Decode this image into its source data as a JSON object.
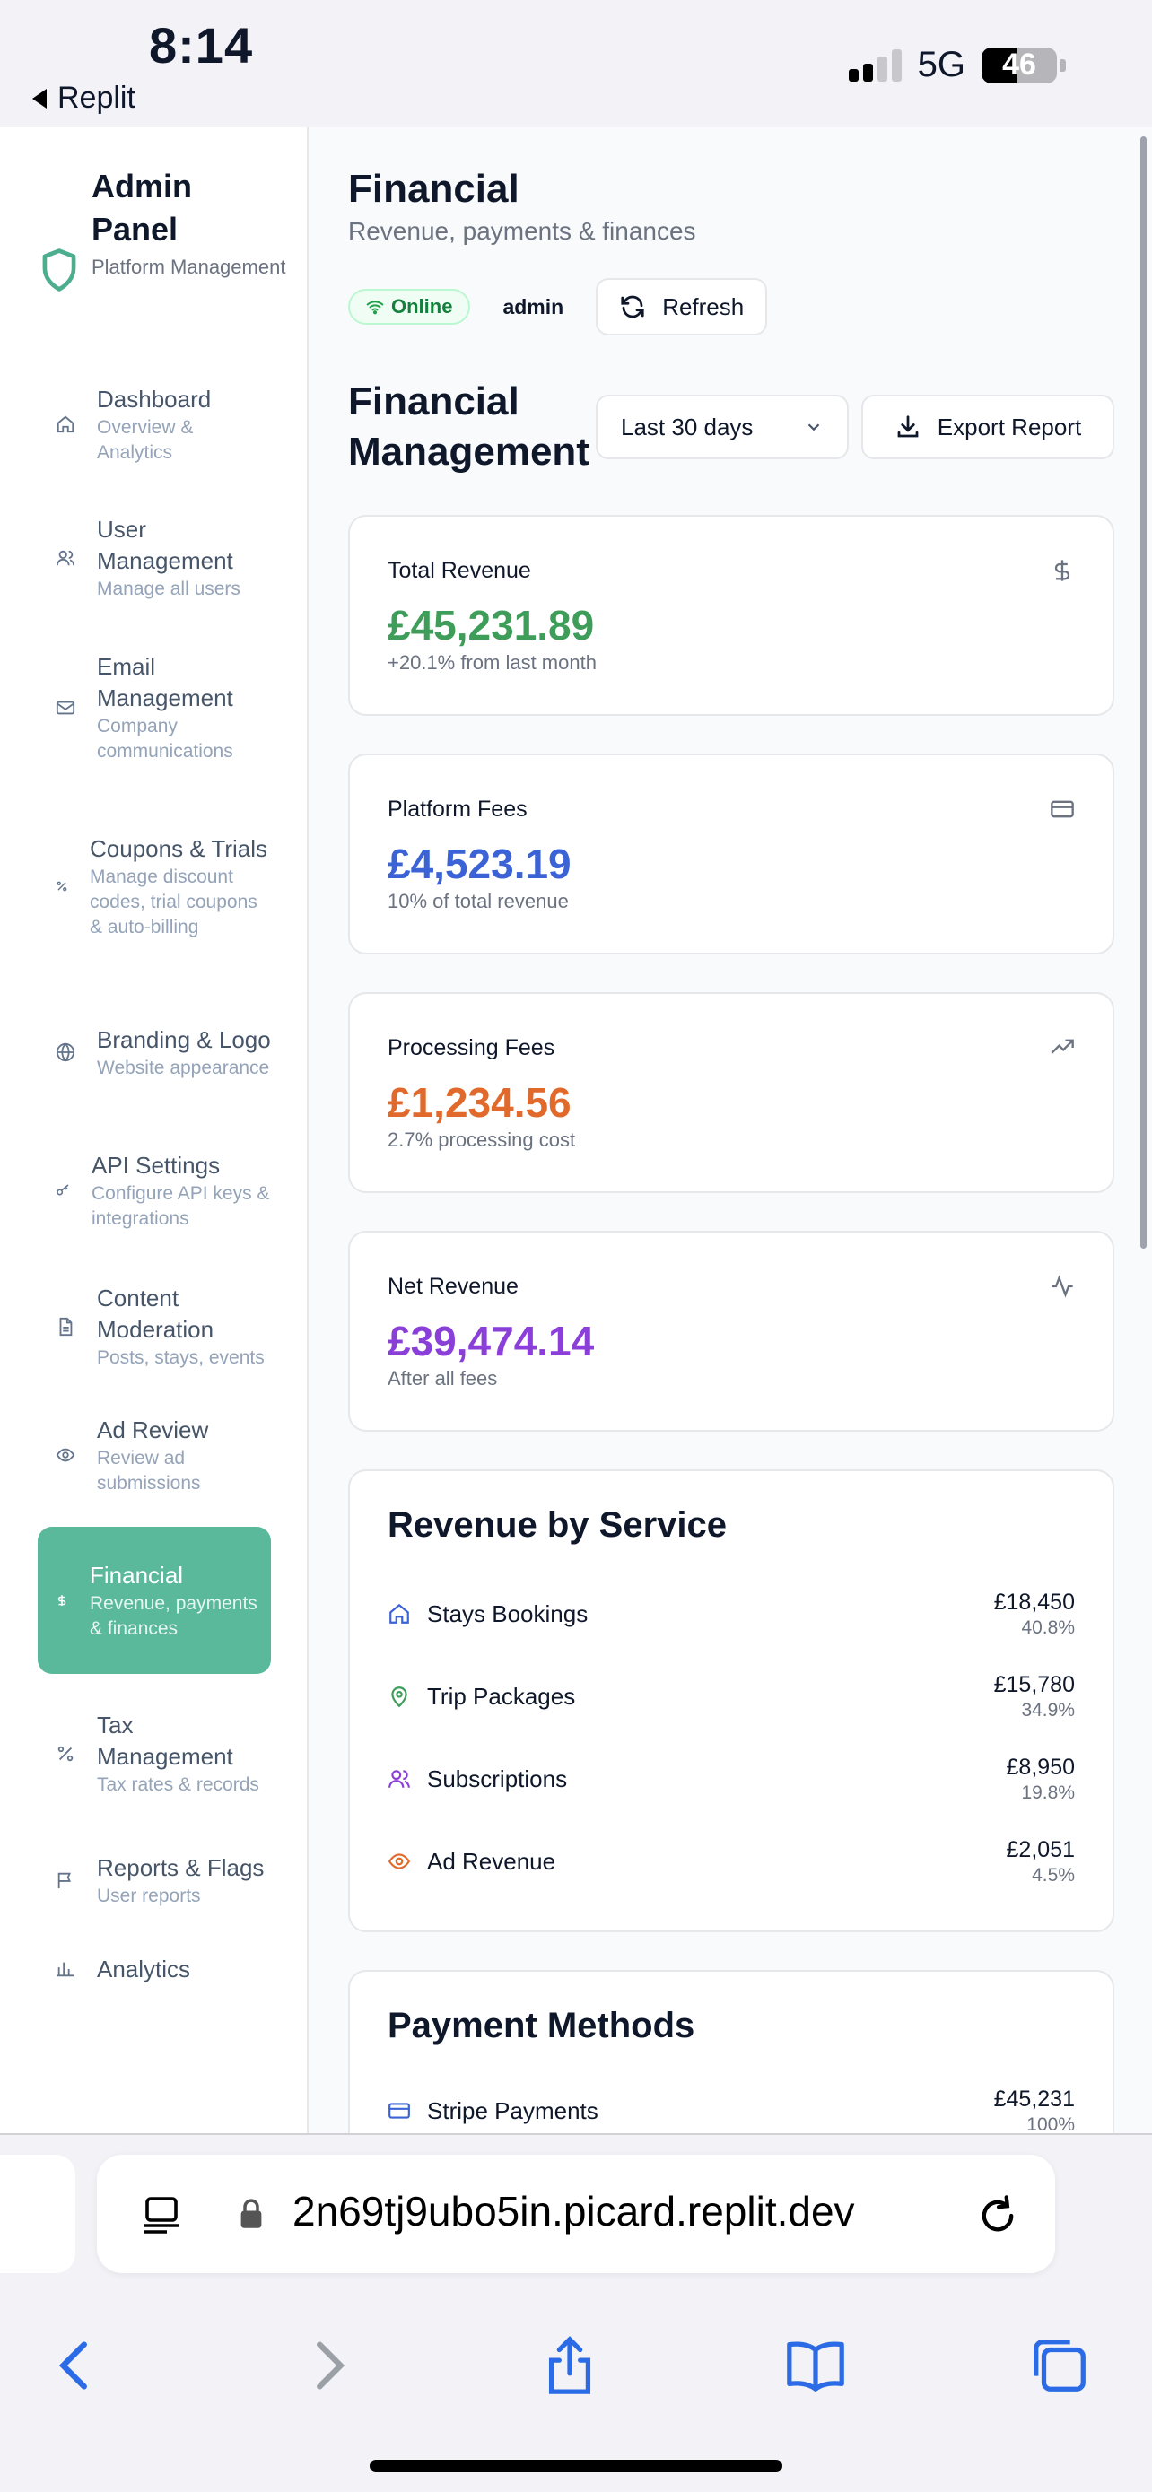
{
  "status_bar": {
    "time": "8:14",
    "back_label": "Replit",
    "network": "5G",
    "battery": "46",
    "battery_level": 0.46
  },
  "sidebar": {
    "title": "Admin Panel",
    "subtitle": "Platform Management",
    "items": [
      {
        "label": "Dashboard",
        "sub": "Overview & Analytics",
        "icon": "home-icon"
      },
      {
        "label": "User Management",
        "sub": "Manage all users",
        "icon": "users-icon"
      },
      {
        "label": "Email Management",
        "sub": "Company communications",
        "icon": "mail-icon"
      },
      {
        "label": "Coupons & Trials",
        "sub": "Manage discount codes, trial coupons & auto-billing",
        "icon": "percent-icon"
      },
      {
        "label": "Branding & Logo",
        "sub": "Website appearance",
        "icon": "globe-icon"
      },
      {
        "label": "API Settings",
        "sub": "Configure API keys & integrations",
        "icon": "key-icon"
      },
      {
        "label": "Content Moderation",
        "sub": "Posts, stays, events",
        "icon": "file-icon"
      },
      {
        "label": "Ad Review",
        "sub": "Review ad submissions",
        "icon": "eye-icon"
      },
      {
        "label": "Financial",
        "sub": "Revenue, payments & finances",
        "icon": "dollar-icon",
        "active": true
      },
      {
        "label": "Tax Management",
        "sub": "Tax rates & records",
        "icon": "percent-icon"
      },
      {
        "label": "Reports & Flags",
        "sub": "User reports",
        "icon": "flag-icon"
      },
      {
        "label": "Analytics",
        "sub": "",
        "icon": "chart-icon"
      }
    ]
  },
  "header": {
    "title": "Financial",
    "subtitle": "Revenue, payments & finances",
    "status": "Online",
    "user": "admin",
    "refresh_label": "Refresh"
  },
  "financial": {
    "title": "Financial Management",
    "range": "Last 30 days",
    "export_label": "Export Report"
  },
  "stats": [
    {
      "label": "Total Revenue",
      "value": "£45,231.89",
      "note": "+20.1% from last month",
      "color": "#3f9d5a",
      "icon": "dollar-icon"
    },
    {
      "label": "Platform Fees",
      "value": "£4,523.19",
      "note": "10% of total revenue",
      "color": "#3b63d6",
      "icon": "credit-card-icon"
    },
    {
      "label": "Processing Fees",
      "value": "£1,234.56",
      "note": "2.7% processing cost",
      "color": "#e0692b",
      "icon": "trending-up-icon"
    },
    {
      "label": "Net Revenue",
      "value": "£39,474.14",
      "note": "After all fees",
      "color": "#8b3fd9",
      "icon": "activity-icon"
    }
  ],
  "revenue_by_service": {
    "title": "Revenue by Service",
    "rows": [
      {
        "name": "Stays Bookings",
        "amount": "£18,450",
        "pct": "40.8%",
        "icon": "home-icon",
        "color": "#3b63d6"
      },
      {
        "name": "Trip Packages",
        "amount": "£15,780",
        "pct": "34.9%",
        "icon": "map-pin-icon",
        "color": "#3f9d5a"
      },
      {
        "name": "Subscriptions",
        "amount": "£8,950",
        "pct": "19.8%",
        "icon": "users-icon",
        "color": "#8b3fd9"
      },
      {
        "name": "Ad Revenue",
        "amount": "£2,051",
        "pct": "4.5%",
        "icon": "eye-icon",
        "color": "#e0692b"
      }
    ]
  },
  "payment_methods": {
    "title": "Payment Methods",
    "rows": [
      {
        "name": "Stripe Payments",
        "amount": "£45,231",
        "pct": "100%",
        "icon": "credit-card-icon",
        "color": "#3b63d6"
      }
    ]
  },
  "browser": {
    "url": "2n69tj9ubo5in.picard.replit.dev"
  }
}
